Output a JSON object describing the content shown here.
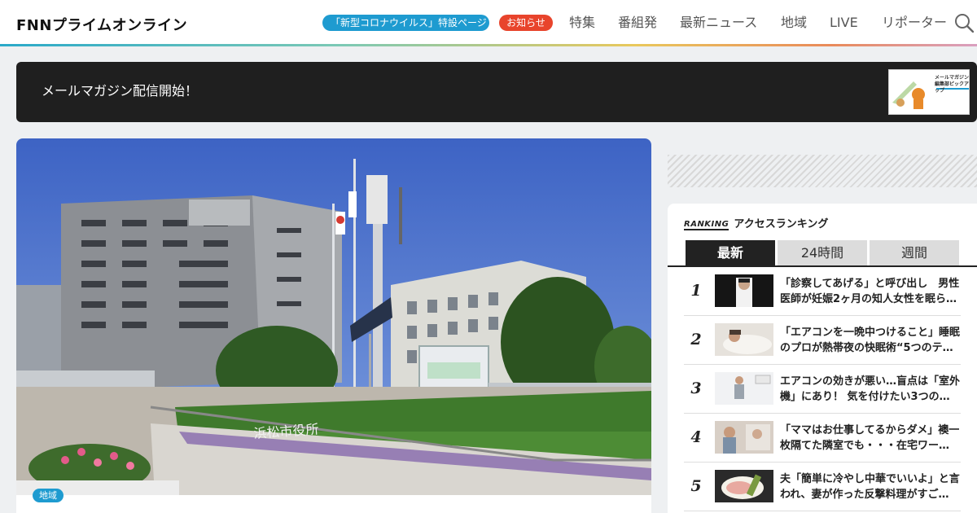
{
  "header": {
    "logo_text": "FNNプライムオンライン",
    "corona_label": "「新型コロナウイルス」特設ページ",
    "notice_label": "お知らせ",
    "nav": [
      "特集",
      "番組発",
      "最新ニュース",
      "地域",
      "LIVE",
      "リポーター"
    ]
  },
  "banner": {
    "text": "メールマガジン配信開始！",
    "thumb_caption": "メールマガジン\n編集部ピックアップ"
  },
  "article": {
    "photo_sign": "浜松市役所",
    "tag": "地域"
  },
  "ranking": {
    "logo": "RANKING",
    "heading": "アクセスランキング",
    "tabs": [
      "最新",
      "24時間",
      "週間"
    ],
    "active_tab": "最新",
    "items": [
      {
        "rank": "1",
        "title": "「診察してあげる」と呼び出し　男性医師が妊娠2ヶ月の知人女性を眠ら…"
      },
      {
        "rank": "2",
        "title": "「エアコンを一晩中つけること」睡眠のプロが熱帯夜の快眠術“5つのテ…"
      },
      {
        "rank": "3",
        "title": "エアコンの効きが悪い…盲点は「室外機」にあり！ 気を付けたい3つの…"
      },
      {
        "rank": "4",
        "title": "「ママはお仕事してるからダメ」襖一枚隔てた隣室でも・・・在宅ワー…"
      },
      {
        "rank": "5",
        "title": "夫「簡単に冷やし中華でいいよ」と言われ、妻が作った反撃料理がすご…"
      }
    ]
  },
  "colors": {
    "accent_blue": "#1e9bd0",
    "accent_red": "#e8442c",
    "banner_bg": "#1f1f1f"
  }
}
